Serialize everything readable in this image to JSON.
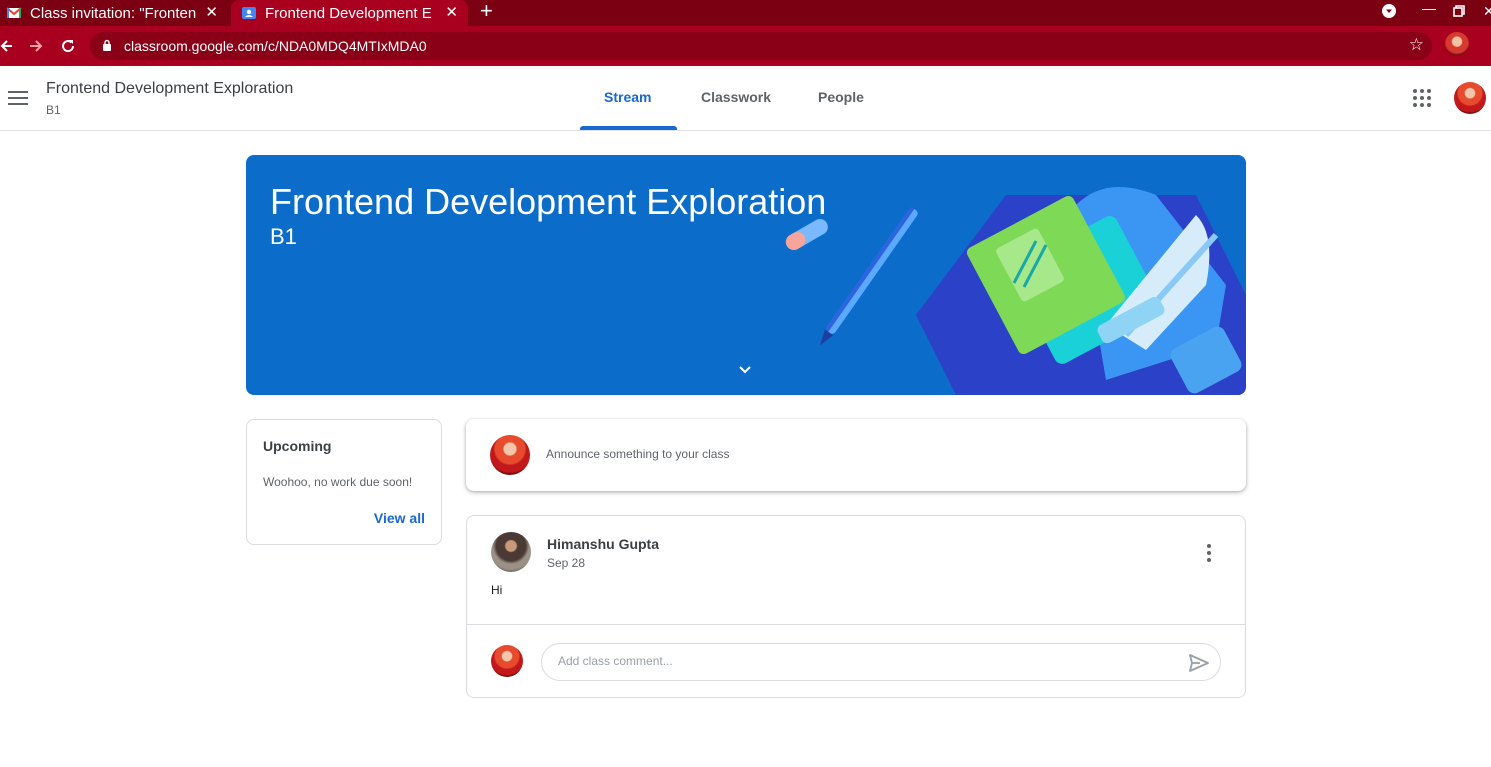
{
  "browser": {
    "tabs": [
      {
        "title": "Class invitation: \"Fronten",
        "active": false,
        "favicon": "gmail-icon"
      },
      {
        "title": "Frontend Development E",
        "active": true,
        "favicon": "classroom-icon"
      }
    ],
    "url": "classroom.google.com/c/NDA0MDQ4MTIxMDA0",
    "colors": {
      "tabstrip": "#7a0012",
      "toolbar": "#a8001e"
    }
  },
  "header": {
    "class_name": "Frontend Development Exploration",
    "section": "B1",
    "tabs": [
      {
        "label": "Stream",
        "active": true
      },
      {
        "label": "Classwork",
        "active": false
      },
      {
        "label": "People",
        "active": false
      }
    ]
  },
  "banner": {
    "title": "Frontend Development Exploration",
    "subtitle": "B1",
    "color": "#0b6cc9"
  },
  "upcoming": {
    "title": "Upcoming",
    "message": "Woohoo, no work due soon!",
    "view_all": "View all"
  },
  "announce": {
    "placeholder": "Announce something to your class"
  },
  "post": {
    "author": "Himanshu Gupta",
    "date": "Sep 28",
    "body": "Hi",
    "comment_placeholder": "Add class comment..."
  },
  "accent": "#1967d2"
}
